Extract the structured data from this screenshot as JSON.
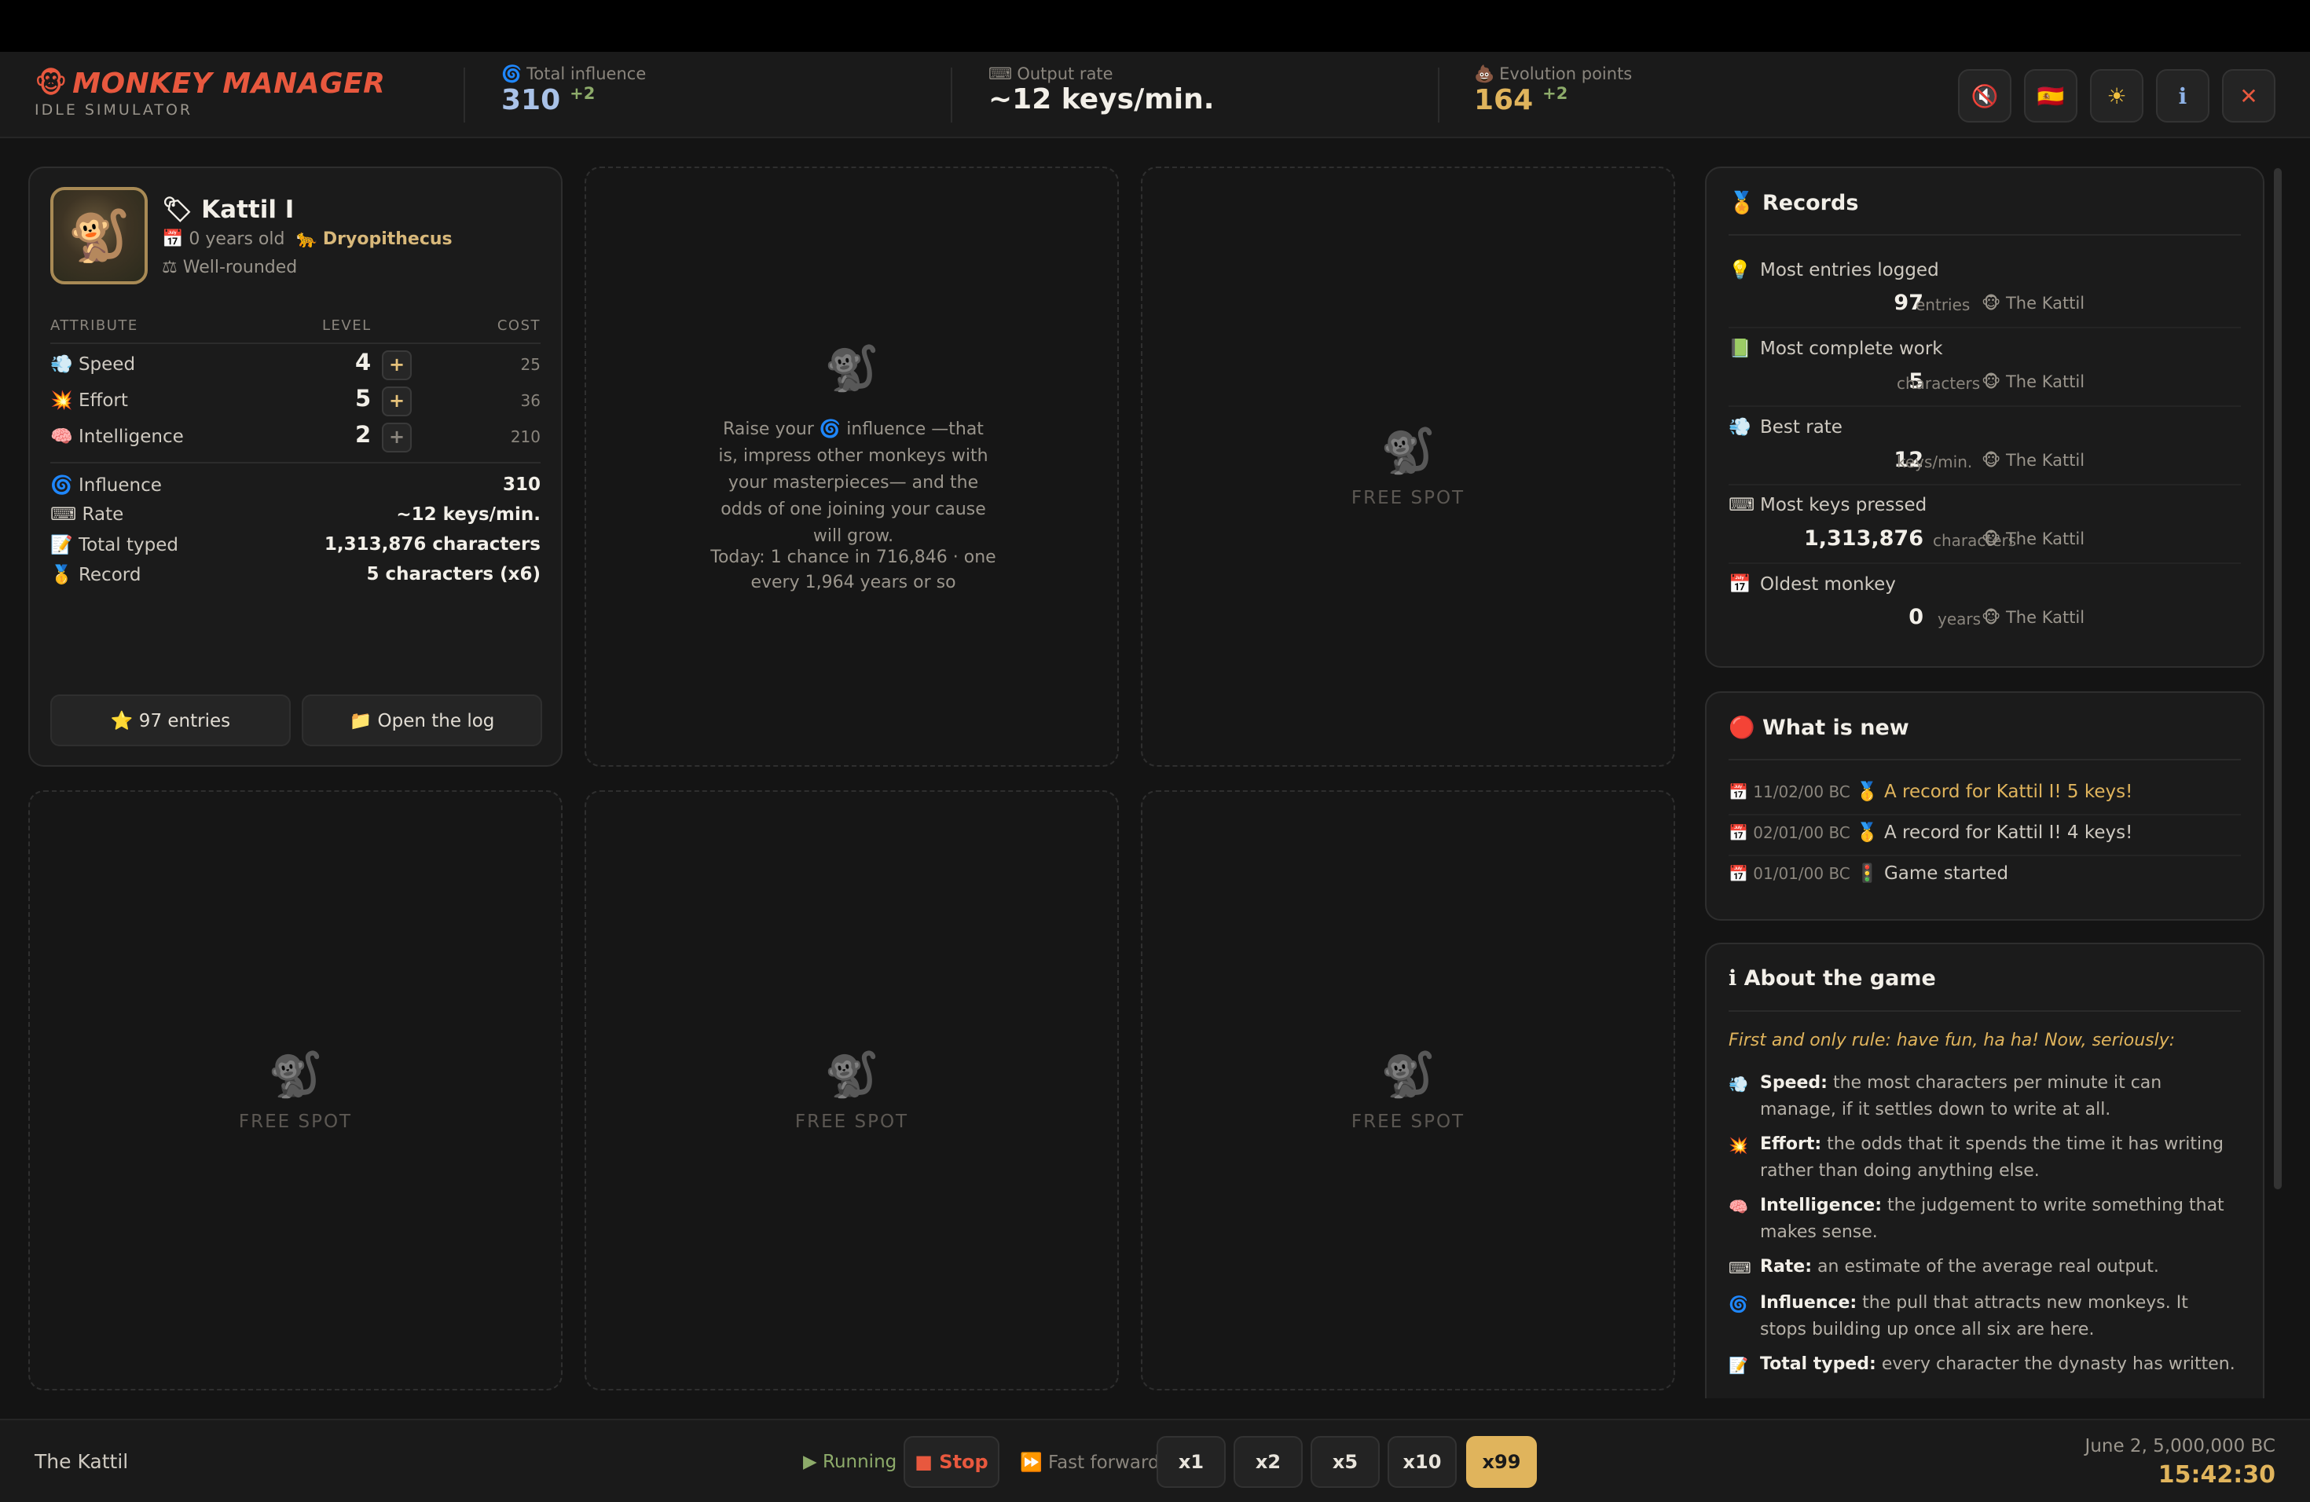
{
  "header": {
    "logo_icon": "🐵",
    "title": "MONKEY MANAGER",
    "subtitle": "IDLE SIMULATOR",
    "stats": [
      {
        "icon": "🌀",
        "label": "Total influence",
        "value": "310",
        "delta": "+2",
        "color": "#a9c2e8"
      },
      {
        "icon": "⌨",
        "label": "Output rate",
        "value": "~12 keys/min.",
        "delta": "",
        "color": "#f2efe8"
      },
      {
        "icon": "💩",
        "label": "Evolution points",
        "value": "164",
        "delta": "+2",
        "color": "#e0b45c"
      }
    ],
    "buttons": [
      {
        "name": "mute-button",
        "icon": "🔇"
      },
      {
        "name": "language-button",
        "icon": "🇪🇸"
      },
      {
        "name": "theme-button",
        "icon": "☀"
      },
      {
        "name": "info-button",
        "icon": "ℹ"
      },
      {
        "name": "close-button",
        "icon": "✕"
      }
    ]
  },
  "monkey": {
    "avatar_icon": "🐒",
    "tag_icon": "🏷",
    "name": "Kattil I",
    "age_icon": "📅",
    "age": "0 years old",
    "species_icon": "🐆",
    "species": "Dryopithecus",
    "trait_icon": "⚖",
    "trait": "Well-rounded",
    "columns": {
      "attribute": "ATTRIBUTE",
      "level": "LEVEL",
      "cost": "COST"
    },
    "attributes": [
      {
        "icon": "💨",
        "name": "Speed",
        "level": "4",
        "cost": "25"
      },
      {
        "icon": "💥",
        "name": "Effort",
        "level": "5",
        "cost": "36"
      },
      {
        "icon": "🧠",
        "name": "Intelligence",
        "level": "2",
        "cost": "210"
      }
    ],
    "plus": "+",
    "stats": [
      {
        "icon": "🌀",
        "label": "Influence",
        "value": "310"
      },
      {
        "icon": "⌨",
        "label": "Rate",
        "value": "~12 keys/min."
      },
      {
        "icon": "📝",
        "label": "Total typed",
        "value": "1,313,876 characters"
      },
      {
        "icon": "🥇",
        "label": "Record",
        "value": "5 characters (x6)"
      }
    ],
    "entries_button": "⭐ 97 entries",
    "log_button": "📁 Open the log"
  },
  "recruit_hint": {
    "icon": "🐒",
    "line1": "Raise your 🌀 influence —that is, impress other monkeys with your masterpieces— and the odds of one joining your cause will grow.",
    "line2": "Today: 1 chance in 716,846 · one every 1,964 years or so"
  },
  "free_spot": {
    "icon": "🐒",
    "label": "FREE SPOT"
  },
  "records": {
    "title": "🏅 Records",
    "items": [
      {
        "icon": "💡",
        "label": "Most entries logged",
        "value": "97",
        "unit": "entries",
        "who": "🐵 The Kattil"
      },
      {
        "icon": "📗",
        "label": "Most complete work",
        "value": "5",
        "unit": "characters",
        "who": "🐵 The Kattil"
      },
      {
        "icon": "💨",
        "label": "Best rate",
        "value": "12",
        "unit": "keys/min.",
        "who": "🐵 The Kattil"
      },
      {
        "icon": "⌨",
        "label": "Most keys pressed",
        "value": "1,313,876",
        "unit": "characters",
        "who": "🐵 The Kattil"
      },
      {
        "icon": "📅",
        "label": "Oldest monkey",
        "value": "0",
        "unit": "years",
        "who": "🐵 The Kattil"
      }
    ]
  },
  "news": {
    "title": "🔴 What is new",
    "items": [
      {
        "date": "📅 11/02/00 BC",
        "text": "🥇 A record for Kattil I! 5 keys!",
        "highlight": true
      },
      {
        "date": "📅 02/01/00 BC",
        "text": "🥇 A record for Kattil I! 4 keys!",
        "highlight": false
      },
      {
        "date": "📅 01/01/00 BC",
        "text": "🚦 Game started",
        "highlight": false
      }
    ]
  },
  "about": {
    "title": "ℹ About the game",
    "lead": "First and only rule: have fun, ha ha! Now, seriously:",
    "items": [
      {
        "icon": "💨",
        "term": "Speed:",
        "desc": "the most characters per minute it can manage, if it settles down to write at all."
      },
      {
        "icon": "💥",
        "term": "Effort:",
        "desc": "the odds that it spends the time it has writing rather than doing anything else."
      },
      {
        "icon": "🧠",
        "term": "Intelligence:",
        "desc": "the judgement to write something that makes sense."
      },
      {
        "icon": "⌨",
        "term": "Rate:",
        "desc": "an estimate of the average real output."
      },
      {
        "icon": "🌀",
        "term": "Influence:",
        "desc": "the pull that attracts new monkeys. It stops building up once all six are here."
      },
      {
        "icon": "📝",
        "term": "Total typed:",
        "desc": "every character the dynasty has written."
      }
    ]
  },
  "footer": {
    "dynasty": "The Kattil",
    "status": "▶ Running",
    "stop": "■ Stop",
    "fast_forward": "⏩ Fast forward",
    "speeds": [
      "x1",
      "x2",
      "x5",
      "x10",
      "x99"
    ],
    "active_speed": "x99",
    "date": "June 2, 5,000,000 BC",
    "time": "15:42:30"
  }
}
